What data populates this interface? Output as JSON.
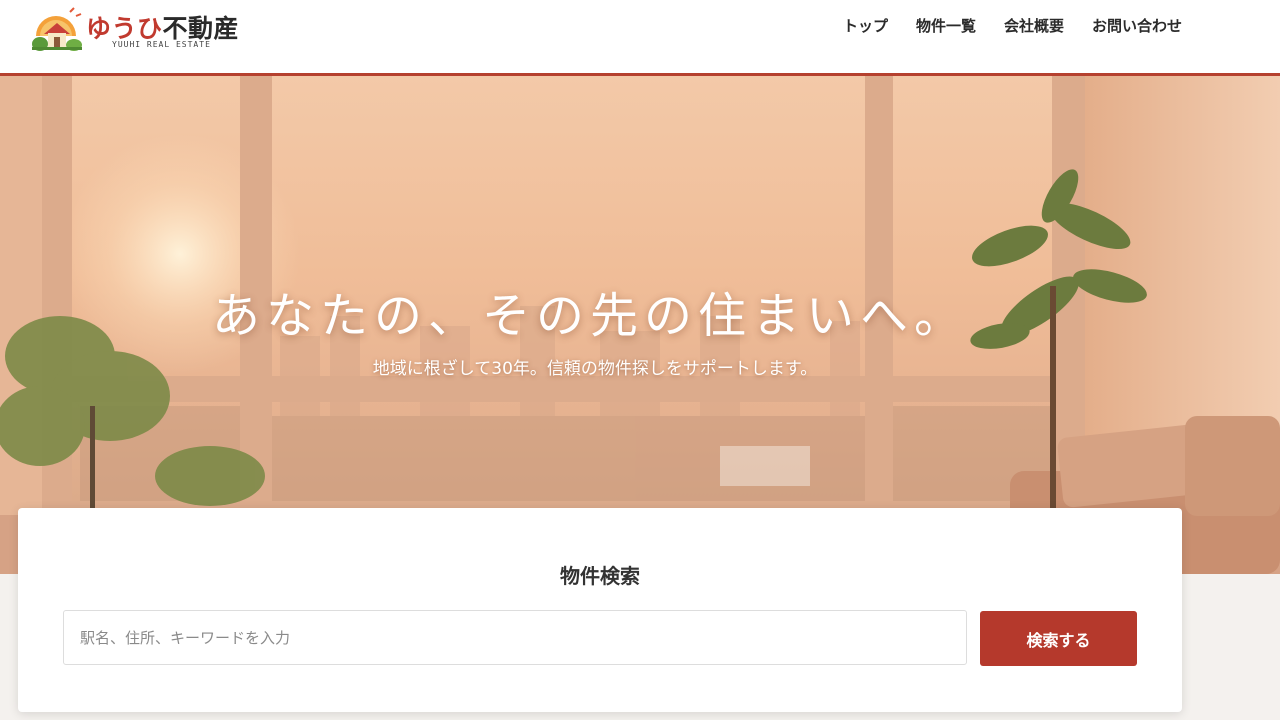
{
  "header": {
    "logo": {
      "title_red": "ゆうひ",
      "title_dark": "不動産",
      "subtitle": "YUUHI REAL ESTATE"
    },
    "nav": [
      {
        "label": "トップ"
      },
      {
        "label": "物件一覧"
      },
      {
        "label": "会社概要"
      },
      {
        "label": "お問い合わせ"
      }
    ],
    "accent_color": "#b5412f"
  },
  "hero": {
    "title": "あなたの、その先の住まいへ。",
    "subtitle": "地域に根ざして30年。信頼の物件探しをサポートします。"
  },
  "search": {
    "title": "物件検索",
    "placeholder": "駅名、住所、キーワードを入力",
    "button_label": "検索する",
    "button_color": "#b5392c"
  }
}
